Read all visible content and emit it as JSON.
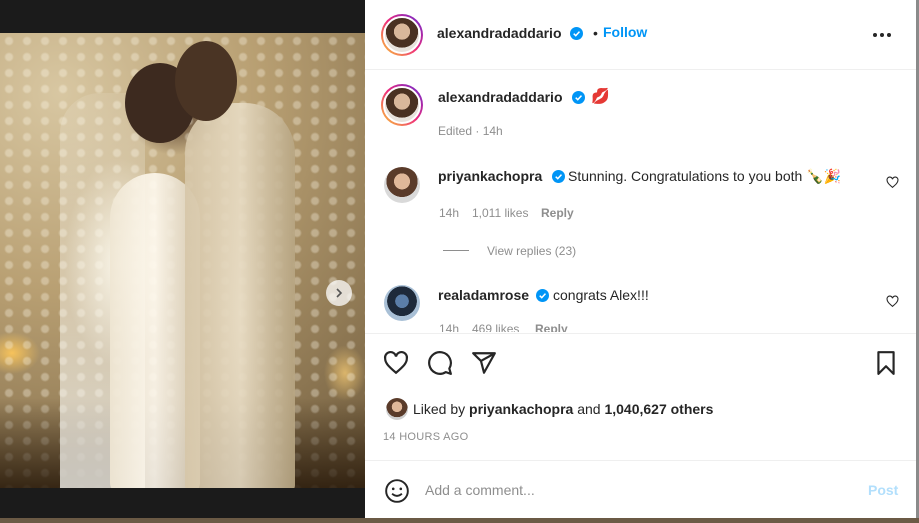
{
  "post": {
    "author": "alexandradaddario",
    "follow_sep": "•",
    "follow_label": "Follow",
    "caption_emoji": "💋",
    "caption_meta": "Edited · 14h"
  },
  "comments": [
    {
      "user": "priyankachopra",
      "text": "Stunning. Congratulations to you both 🍾🎉",
      "time": "14h",
      "likes": "1,011 likes",
      "reply_label": "Reply",
      "view_replies": "View replies (23)"
    },
    {
      "user": "realadamrose",
      "text": "congrats Alex!!!",
      "time": "14h",
      "likes": "469 likes",
      "reply_label": "Reply"
    }
  ],
  "likes_summary": {
    "prefix": "Liked by",
    "user": "priyankachopra",
    "joiner": "and",
    "count": "1,040,627 others"
  },
  "timestamp": "14 HOURS AGO",
  "add_comment": {
    "placeholder": "Add a comment...",
    "post_label": "Post"
  },
  "carousel": {
    "total": 3,
    "active": 1
  },
  "colors": {
    "link_blue": "#0095f6",
    "post_disabled": "#b2dffc",
    "verified": "#0095f6",
    "muted": "#8e8e8e"
  },
  "icons": [
    "heart-icon",
    "comment-icon",
    "share-icon",
    "bookmark-icon",
    "emoji-icon",
    "more-icon",
    "verified-icon",
    "chevron-right-icon"
  ]
}
